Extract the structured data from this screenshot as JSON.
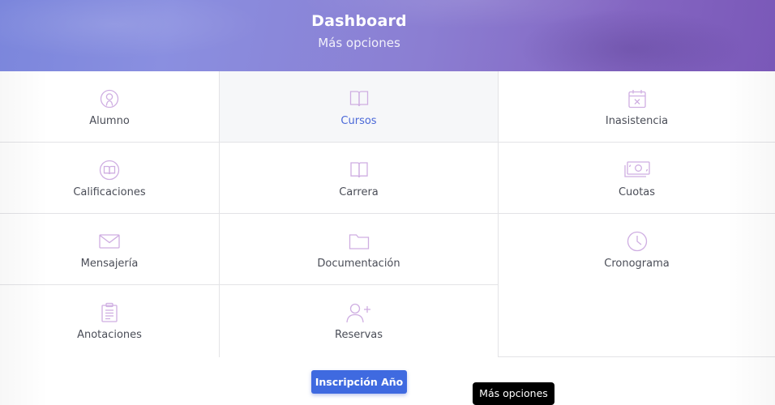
{
  "header": {
    "title": "Dashboard",
    "subtitle": "Más opciones"
  },
  "colors": {
    "accent": "#3f6ae0",
    "active_label": "#4a68d8",
    "icon_stroke": "#cfaee2",
    "header_gradient_start": "#7b86dc",
    "header_gradient_end": "#7a58b8"
  },
  "menu": {
    "items": [
      {
        "label": "Alumno",
        "icon": "user-circle-icon",
        "active": false
      },
      {
        "label": "Cursos",
        "icon": "open-book-icon",
        "active": true
      },
      {
        "label": "Inasistencia",
        "icon": "calendar-x-icon",
        "active": false
      },
      {
        "label": "Calificaciones",
        "icon": "book-circle-icon",
        "active": false
      },
      {
        "label": "Carrera",
        "icon": "open-book-icon",
        "active": false
      },
      {
        "label": "Cuotas",
        "icon": "cash-icon",
        "active": false
      },
      {
        "label": "Mensajería",
        "icon": "envelope-icon",
        "active": false
      },
      {
        "label": "Documentación",
        "icon": "folder-icon",
        "active": false
      },
      {
        "label": "Cronograma",
        "icon": "clock-icon",
        "active": false
      },
      {
        "label": "Anotaciones",
        "icon": "clipboard-icon",
        "active": false
      },
      {
        "label": "Reservas",
        "icon": "user-plus-icon",
        "active": false
      }
    ]
  },
  "footer": {
    "button_label": "Inscripción Año"
  },
  "tooltip": {
    "text": "Más opciones"
  }
}
